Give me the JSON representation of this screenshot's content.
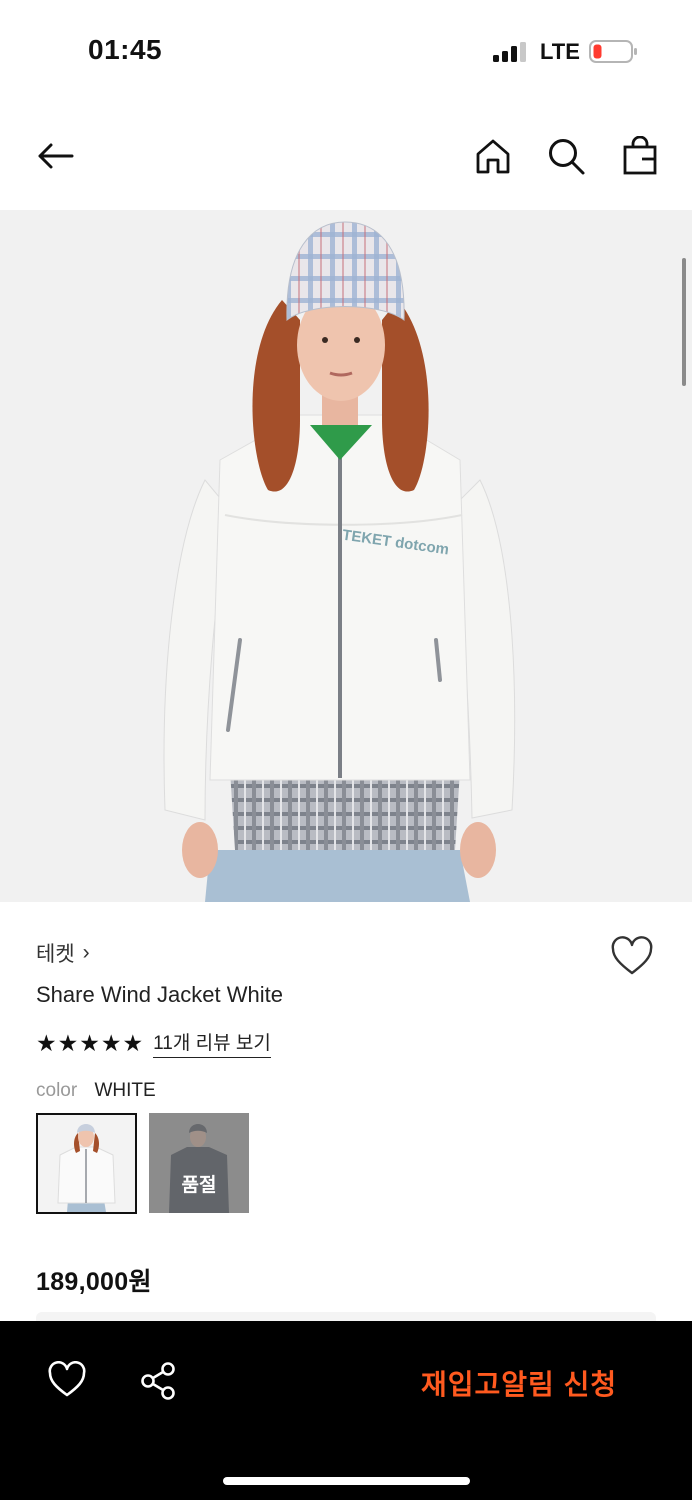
{
  "status_bar": {
    "time": "01:45",
    "network": "LTE"
  },
  "nav": {
    "back_icon": "arrow-left-icon",
    "home_icon": "home-icon",
    "search_icon": "search-icon",
    "bag_icon": "shopping-bag-icon"
  },
  "product": {
    "brand": "테켓",
    "brand_chevron": "›",
    "name": "Share Wind Jacket White",
    "rating_stars": 5,
    "review_link": "11개 리뷰 보기",
    "color_label": "color",
    "color_value": "WHITE",
    "swatches": [
      {
        "color": "WHITE",
        "selected": true
      },
      {
        "color": "NAVY",
        "status_label": "품절"
      }
    ],
    "price": "189,000원",
    "hero_print": "TEKET dotcom"
  },
  "bottom_bar": {
    "restock_label": "재입고알림 신청",
    "heart_icon": "heart-outline-icon",
    "share_icon": "share-icon"
  },
  "colors": {
    "accent": "#ff5a1f",
    "bottom_bar_bg": "#000000",
    "text": "#1a1a1a",
    "muted": "#999999"
  }
}
